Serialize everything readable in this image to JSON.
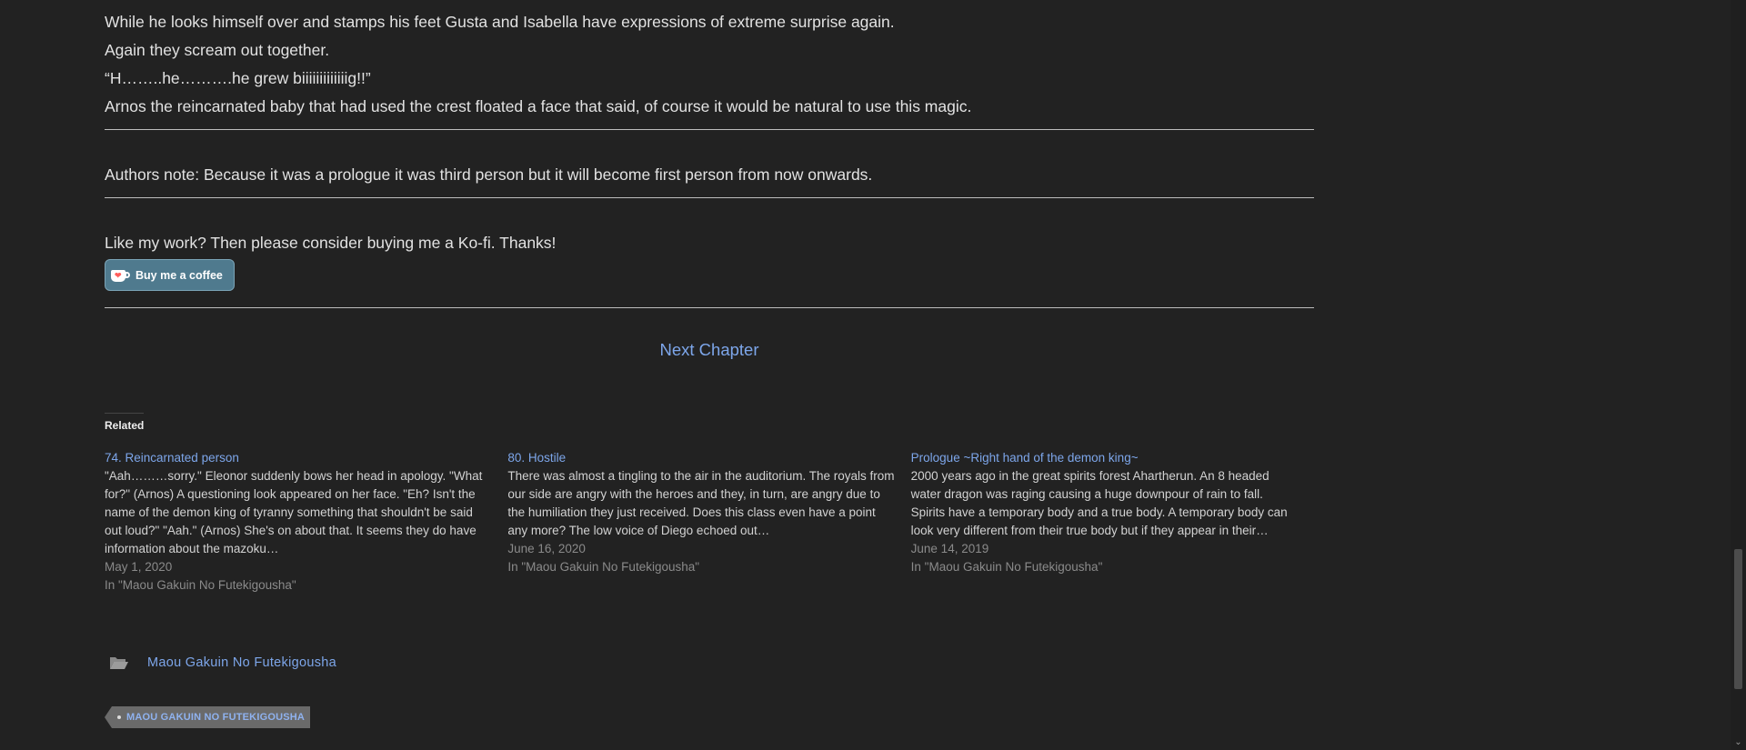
{
  "story": {
    "paragraphs": [
      "While he looks himself over and stamps his feet Gusta and Isabella have expressions of extreme surprise again.",
      "Again they scream out together.",
      "“H……..he……….he grew biiiiiiiiiiiiig!!”",
      "Arnos the reincarnated baby that had used the crest floated a face that said, of course it would be natural to use this magic."
    ]
  },
  "authors_note": "Authors note: Because it was a prologue it was third person but it will become first person from now onwards.",
  "kofi": {
    "text": "Like my work? Then please consider buying me a Ko-fi. Thanks!",
    "button_label": "Buy me a coffee"
  },
  "next_chapter": "Next Chapter",
  "related": {
    "heading": "Related",
    "items": [
      {
        "title": "74. Reincarnated person",
        "excerpt": "\"Aah………sorry.\" Eleonor suddenly bows her head in apology. \"What for?\" (Arnos) A questioning look appeared on her face. \"Eh? Isn't the name of the demon king of tyranny something that shouldn't be said out loud?\" \"Aah.\" (Arnos) She's on about that. It seems they do have information about the mazoku…",
        "date": "May 1, 2020",
        "category": "In \"Maou Gakuin No Futekigousha\""
      },
      {
        "title": "80. Hostile",
        "excerpt": "There was almost a tingling to the air in the auditorium. The royals from our side are angry with the heroes and they, in turn, are angry due to the humiliation they just received. Does this class even have a point any more? The low voice of Diego echoed out…",
        "date": "June 16, 2020",
        "category": "In \"Maou Gakuin No Futekigousha\""
      },
      {
        "title": "Prologue ~Right hand of the demon king~",
        "excerpt": "2000 years ago in the great spirits forest Ahartherun. An 8 headed water dragon was raging causing a huge downpour of rain to fall. Spirits have a temporary body and a true body. A temporary body can look very different from their true body but if they appear in their…",
        "date": "June 14, 2019",
        "category": "In \"Maou Gakuin No Futekigousha\""
      }
    ]
  },
  "category_link": "Maou Gakuin No Futekigousha",
  "tag_label": "MAOU GAKUIN NO FUTEKIGOUSHA",
  "icons": {
    "category": "folder-open-icon",
    "kofi": "coffee-cup-icon",
    "scroll_down": "chevron-down-icon"
  },
  "colors": {
    "background": "#222222",
    "link": "#7da6ea",
    "kofi_button": "#4f7a8e",
    "tag_bg": "#6a6a6a"
  }
}
